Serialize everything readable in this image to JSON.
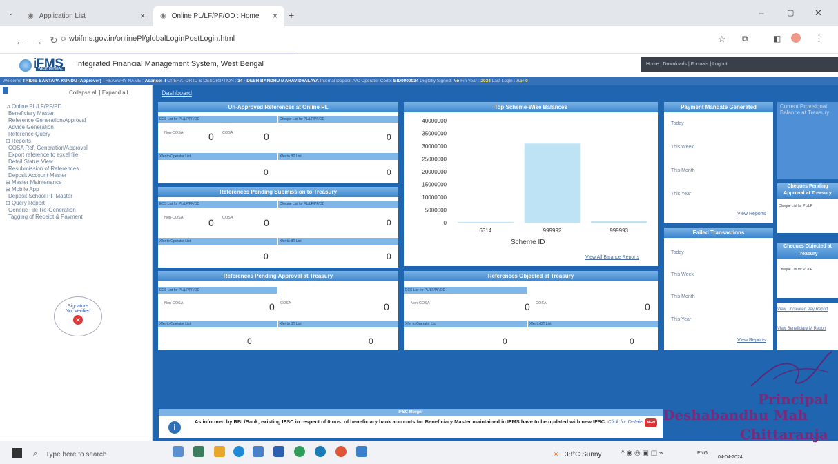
{
  "browser": {
    "tabs": [
      {
        "label": "Application List"
      },
      {
        "label": "Online PL/LF/PF/OD : Home"
      }
    ],
    "url": "wbifms.gov.in/onlinePl/globalLoginPostLogin.html"
  },
  "header": {
    "logo": "iFMS",
    "logo_sub": "WEST BENGAL",
    "title": "Integrated Financial Management System, West Bengal",
    "links": [
      "Home",
      "Downloads",
      "Formats",
      "Logout"
    ]
  },
  "welcome_bar": {
    "prefix": "Welcome",
    "user": "TRIDIB SANTAPA KUNDU (Approver)",
    "treasury_lbl": "TREASURY NAME :",
    "treasury": "Asansol II",
    "operator_lbl": "OPERATOR ID & DESCRIPTION :",
    "operator": "34 - DESH BANDHU MAHAVIDYALAYA",
    "deposit_lbl": "Internal Deposit A/C Operator Code:",
    "deposit": "BID0000034",
    "signed_lbl": "Digitally Signed:",
    "signed": "No",
    "fin_lbl": "Fin Year :",
    "fin": "2024",
    "last_lbl": "Last Login :",
    "last": "Apr 0"
  },
  "sidebar": {
    "collapse": "Collapse all",
    "expand": "Expand all",
    "items": [
      "Online PL/LF/PF/PD",
      "Beneficiary Master",
      "Reference Generation/Approval",
      "Advice Generation",
      "Reference Query",
      "Reports",
      "COSA Ref. Generation/Approval",
      "Export reference to excel file",
      "Detail Status View",
      "Resubmission of References",
      "Deposit Account Master",
      "Master Maintenance",
      "Mobile App",
      "Deposit School PF Master",
      "Query Report",
      "Generic File Re-Generation",
      "Tagging of Receipt & Payment"
    ],
    "signature": {
      "line1": "Signature",
      "line2": "Not Verified"
    }
  },
  "dashboard": {
    "tab": "Dashboard"
  },
  "panel_unapproved": {
    "title": "Un-Approved References at Online PL",
    "ecs": "ECS List for PL/LF/PF/OD",
    "cheque": "Cheque List for PL/LF/PF/OD",
    "noncosa": "Non-COSA",
    "noncosa_val": "0",
    "cosa": "COSA",
    "cosa_val": "0",
    "cheque_val": "0",
    "xfer_op": "Xfer to Operator List",
    "xfer_bt": "Xfer to BT List",
    "xfer_op_val": "0",
    "xfer_bt_val": "0"
  },
  "panel_pending": {
    "title": "References Pending Submission to Treasury",
    "ecs": "ECS List for PL/LF/PF/OD",
    "cheque": "Cheque List for PL/LF/PF/OD",
    "noncosa": "Non-COSA",
    "noncosa_val": "0",
    "cosa": "COSA",
    "cosa_val": "0",
    "cheque_val": "0",
    "xfer_op": "Xfer to Operator List",
    "xfer_bt": "Xfer to BT List",
    "xfer_op_val": "0",
    "xfer_bt_val": "0"
  },
  "panel_approval": {
    "title": "References Pending Approval at Treasury",
    "ecs": "ECS List for PL/LF/PF/OD",
    "noncosa": "Non-COSA",
    "noncosa_val": "0",
    "cosa": "COSA",
    "cosa_val": "0",
    "xfer_op": "Xfer to Operator List",
    "xfer_bt": "Xfer to BT List",
    "xfer_op_val": "0",
    "xfer_bt_val": "0"
  },
  "panel_objected": {
    "title": "References Objected at Treasury",
    "ecs": "ECS List for PL/LF/PF/OD",
    "noncosa": "Non-COSA",
    "noncosa_val": "0",
    "cosa": "COSA",
    "cosa_val": "0",
    "xfer_op": "Xfer to Operator List",
    "xfer_bt": "Xfer to BT List",
    "xfer_op_val": "0",
    "xfer_bt_val": "0"
  },
  "chart_panel": {
    "title": "Top Scheme-Wise Balances",
    "link": "View All Balance Reports"
  },
  "chart_data": {
    "type": "bar",
    "xlabel": "Scheme ID",
    "ylabel": "",
    "categories": [
      "6314",
      "999992",
      "999993"
    ],
    "values": [
      300000,
      31000000,
      700000
    ],
    "yticks": [
      "40000000",
      "35000000",
      "30000000",
      "25000000",
      "20000000",
      "15000000",
      "10000000",
      "5000000",
      "0"
    ],
    "ylim": [
      0,
      40000000
    ],
    "bar_color": "#bde3f5"
  },
  "payment_mandate": {
    "title": "Payment Mandate Generated",
    "rows": [
      "Today",
      "This Week",
      "This Month",
      "This Year"
    ],
    "link": "View Reports"
  },
  "failed_tx": {
    "title": "Failed Transactions",
    "rows": [
      "Today",
      "This Week",
      "This Month",
      "This Year"
    ],
    "link": "View Reports"
  },
  "right_col": {
    "current": "Current Provisional Balance at Treasury",
    "cheques_pending": "Cheques Pending Approval at Treasury",
    "cheques_pending_sub": "Cheque List for PL/LF",
    "cheques_objected": "Cheques Objected at Treasury",
    "cheques_objected_sub": "Cheque List for PL/LF",
    "link1": "View Uncleared Pay Report",
    "link2": "View Beneficiary M Report"
  },
  "ifsc": {
    "title": "IFSC Merger",
    "text": "As informed by RBI /Bank, existing IFSC in respect of  0  nos. of beneficiary bank accounts for Beneficiary Master maintained in IFMS have to be updated with new IFSC.",
    "link": "Click for Details"
  },
  "taskbar": {
    "search": "Type here to search",
    "weather": "38°C Sunny",
    "lang": "ENG",
    "date": "04-04-2024"
  },
  "stamp": {
    "line1": "Principal",
    "line2": "Deshabandhu Mah",
    "line3": "Chittaranja"
  }
}
